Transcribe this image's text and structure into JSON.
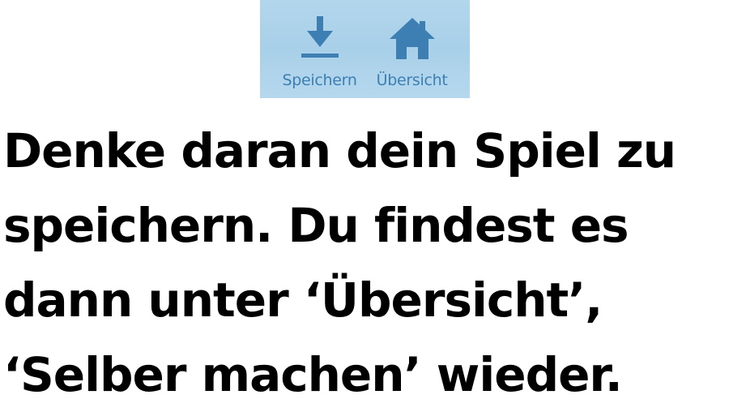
{
  "toolbar": {
    "save_label": "Speichern",
    "overview_label": "Übersicht",
    "save_icon": "download-icon",
    "overview_icon": "home-icon",
    "background_color": "#aed3eb",
    "icon_color": "#3d7fb3"
  },
  "message": {
    "text": "Denke daran dein Spiel zu\nspeichern. Du findest es\ndann unter ‘Übersicht’,\n‘Selber machen’ wieder."
  }
}
